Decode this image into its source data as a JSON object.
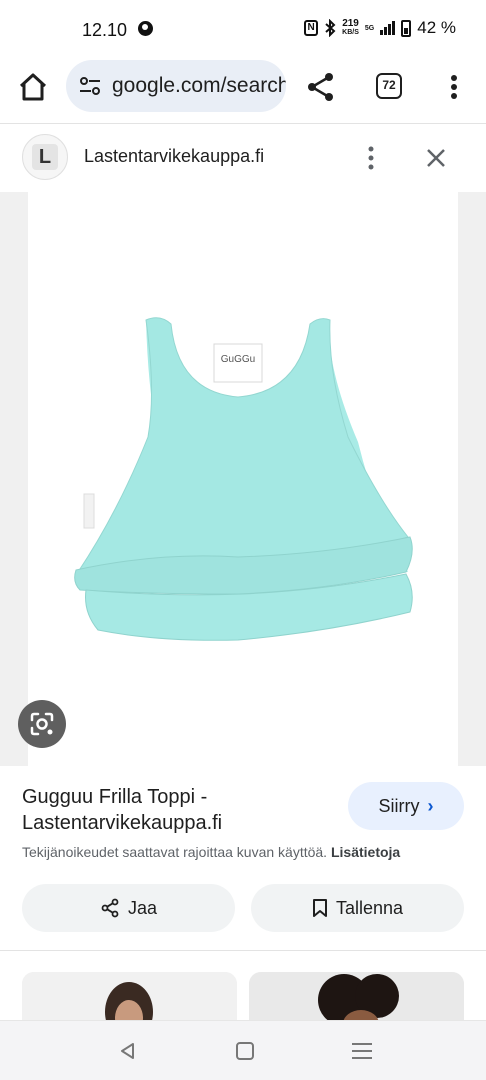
{
  "status_bar": {
    "time": "12.10",
    "net_speed_value": "219",
    "net_speed_unit": "KB/S",
    "network": "5G",
    "battery": "42 %"
  },
  "browser": {
    "url": "google.com/search",
    "tab_count": "72"
  },
  "source": {
    "logo_letter": "L",
    "name": "Lastentarvikekauppa.fi"
  },
  "image": {
    "label_text": "GuGGu",
    "color": "#a9ebe6"
  },
  "result": {
    "title": "Gugguu Frilla Toppi - Lastentarvikekauppa.fi",
    "visit_label": "Siirry",
    "copyright_text": "Tekijänoikeudet saattavat rajoittaa kuvan käyttöä.",
    "more_info_label": "Lisätietoja",
    "share_label": "Jaa",
    "save_label": "Tallenna"
  },
  "icons": {
    "home": "home-icon",
    "share": "share-icon",
    "more": "more-vert-icon",
    "close": "close-icon",
    "lens": "lens-icon",
    "bookmark": "bookmark-icon"
  },
  "colors": {
    "accent": "#0b57d0",
    "pill_bg": "#e8f0fe",
    "url_bg": "#e9eef6"
  }
}
